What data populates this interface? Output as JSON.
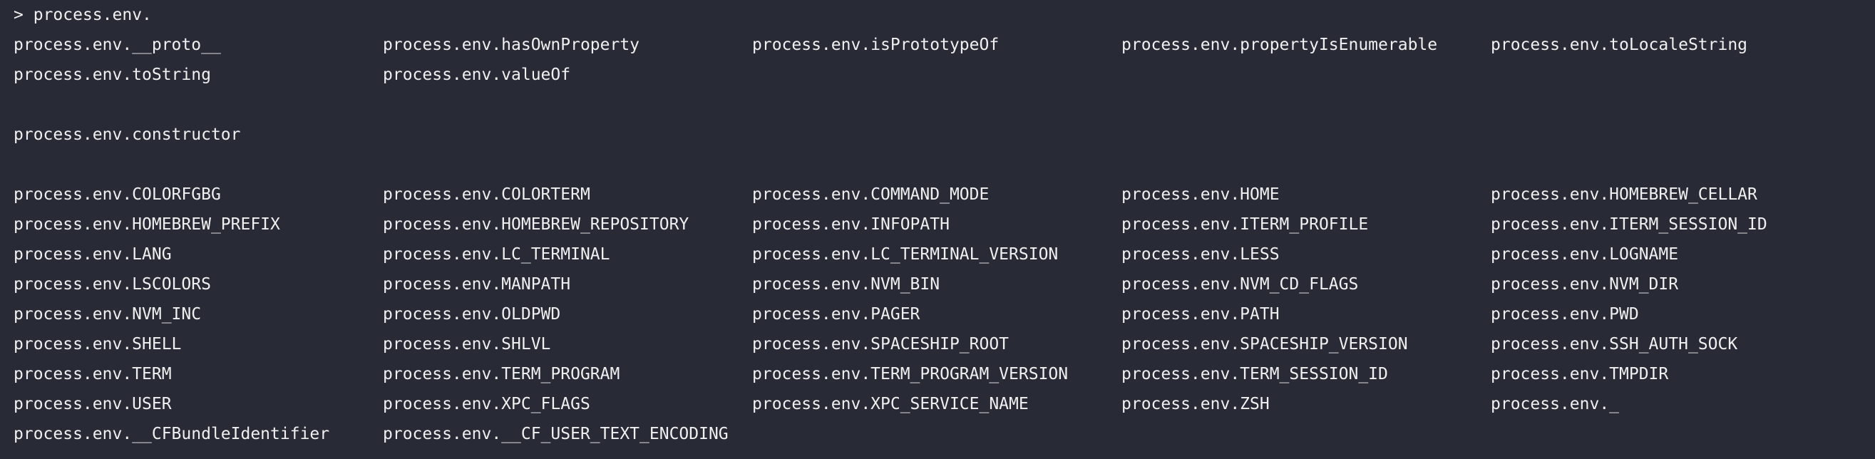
{
  "terminal": {
    "prompt_symbol": ">",
    "input": "process.env.",
    "group1": [
      [
        "process.env.__proto__",
        "process.env.hasOwnProperty",
        "process.env.isPrototypeOf",
        "process.env.propertyIsEnumerable",
        "process.env.toLocaleString"
      ],
      [
        "process.env.toString",
        "process.env.valueOf"
      ]
    ],
    "group2": [
      [
        "process.env.constructor"
      ]
    ],
    "group3": [
      [
        "process.env.COLORFGBG",
        "process.env.COLORTERM",
        "process.env.COMMAND_MODE",
        "process.env.HOME",
        "process.env.HOMEBREW_CELLAR"
      ],
      [
        "process.env.HOMEBREW_PREFIX",
        "process.env.HOMEBREW_REPOSITORY",
        "process.env.INFOPATH",
        "process.env.ITERM_PROFILE",
        "process.env.ITERM_SESSION_ID"
      ],
      [
        "process.env.LANG",
        "process.env.LC_TERMINAL",
        "process.env.LC_TERMINAL_VERSION",
        "process.env.LESS",
        "process.env.LOGNAME"
      ],
      [
        "process.env.LSCOLORS",
        "process.env.MANPATH",
        "process.env.NVM_BIN",
        "process.env.NVM_CD_FLAGS",
        "process.env.NVM_DIR"
      ],
      [
        "process.env.NVM_INC",
        "process.env.OLDPWD",
        "process.env.PAGER",
        "process.env.PATH",
        "process.env.PWD"
      ],
      [
        "process.env.SHELL",
        "process.env.SHLVL",
        "process.env.SPACESHIP_ROOT",
        "process.env.SPACESHIP_VERSION",
        "process.env.SSH_AUTH_SOCK"
      ],
      [
        "process.env.TERM",
        "process.env.TERM_PROGRAM",
        "process.env.TERM_PROGRAM_VERSION",
        "process.env.TERM_SESSION_ID",
        "process.env.TMPDIR"
      ],
      [
        "process.env.USER",
        "process.env.XPC_FLAGS",
        "process.env.XPC_SERVICE_NAME",
        "process.env.ZSH",
        "process.env._"
      ],
      [
        "process.env.__CFBundleIdentifier",
        "process.env.__CF_USER_TEXT_ENCODING"
      ]
    ]
  },
  "colors": {
    "background": "#282a36",
    "text": "#f0f0f0"
  }
}
